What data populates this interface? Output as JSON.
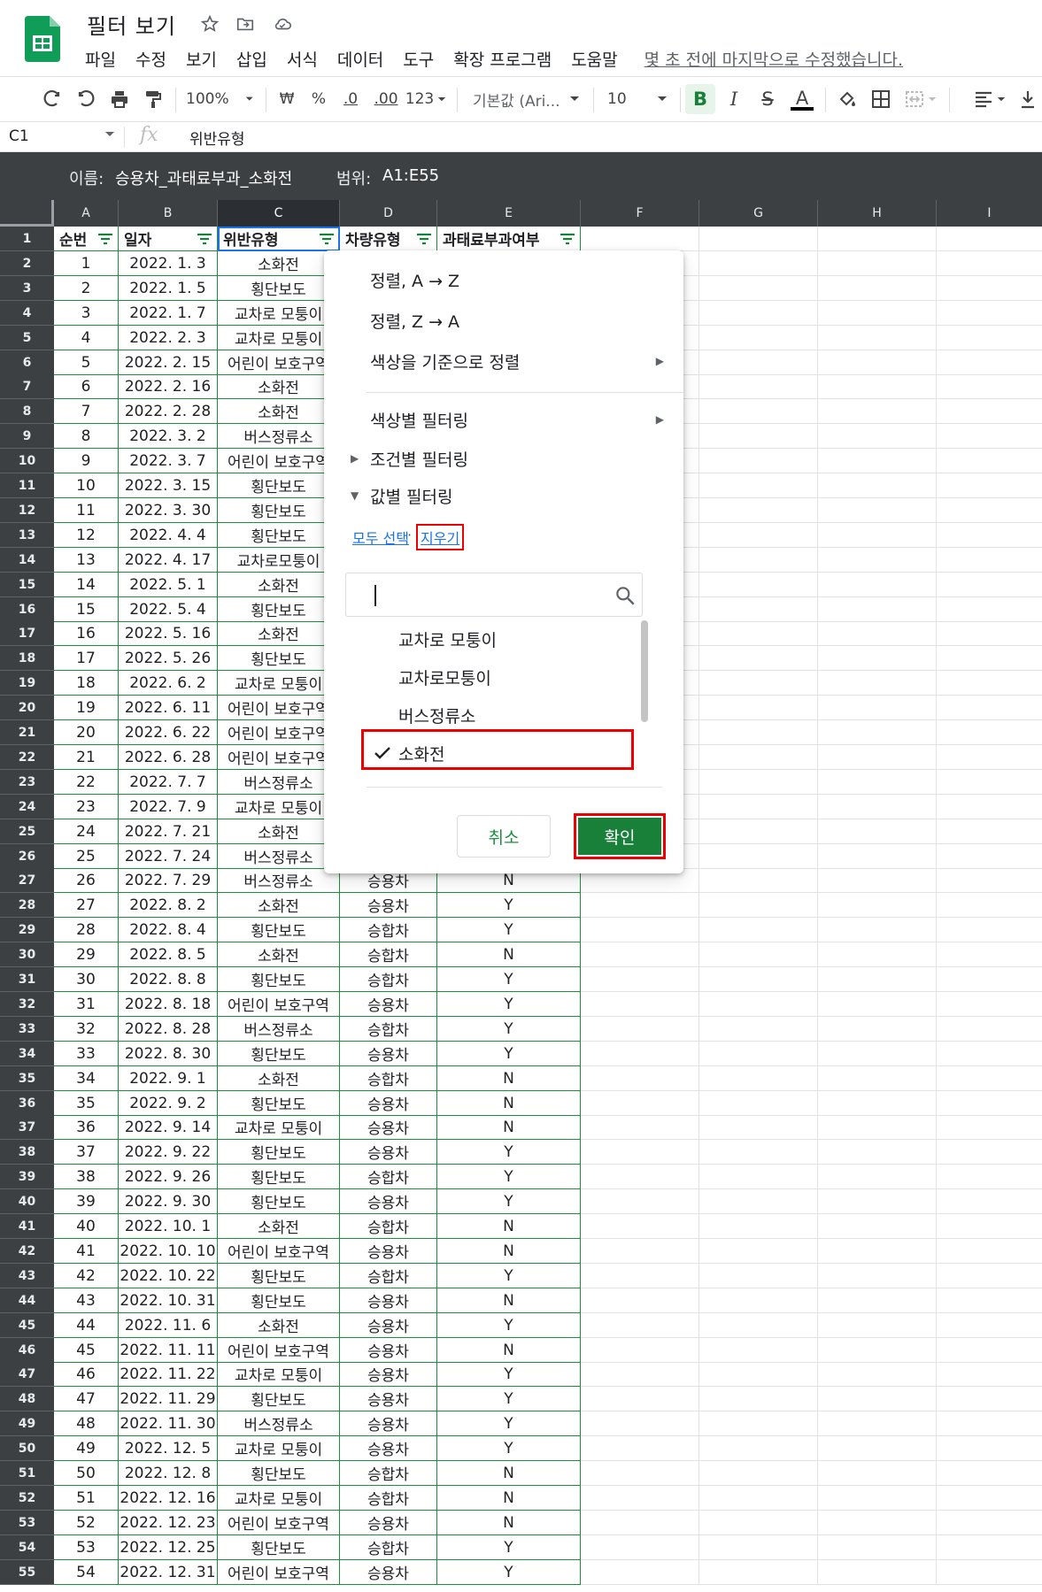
{
  "doc": {
    "title": "필터 보기",
    "last_edit": "몇 초 전에 마지막으로 수정했습니다."
  },
  "menu": [
    "파일",
    "수정",
    "보기",
    "삽입",
    "서식",
    "데이터",
    "도구",
    "확장 프로그램",
    "도움말"
  ],
  "toolbar": {
    "zoom": "100%",
    "currency": "₩",
    "percent": "%",
    "dec_decrease": ".0",
    "dec_increase": ".00",
    "number_format": "123",
    "font": "기본값 (Ari...",
    "font_size": "10",
    "bold": "B",
    "italic": "I",
    "strike": "S",
    "text_color": "A"
  },
  "formula_bar": {
    "cell": "C1",
    "fx": "fx",
    "value": "위반유형"
  },
  "filter_view": {
    "name_label": "이름:",
    "name": "승용차_과태료부과_소화전",
    "range_label": "범위:",
    "range": "A1:E55"
  },
  "columns": [
    "A",
    "B",
    "C",
    "D",
    "E",
    "F",
    "G",
    "H",
    "I"
  ],
  "headers": [
    "순번",
    "일자",
    "위반유형",
    "차량유형",
    "과태료부과여부"
  ],
  "rows": [
    [
      "1",
      "2022. 1. 3",
      "소화전",
      "",
      ""
    ],
    [
      "2",
      "2022. 1. 5",
      "횡단보도",
      "",
      ""
    ],
    [
      "3",
      "2022. 1. 7",
      "교차로 모퉁이",
      "",
      ""
    ],
    [
      "4",
      "2022. 2. 3",
      "교차로 모퉁이",
      "",
      ""
    ],
    [
      "5",
      "2022. 2. 15",
      "어린이 보호구역",
      "",
      ""
    ],
    [
      "6",
      "2022. 2. 16",
      "소화전",
      "",
      ""
    ],
    [
      "7",
      "2022. 2. 28",
      "소화전",
      "",
      ""
    ],
    [
      "8",
      "2022. 3. 2",
      "버스정류소",
      "",
      ""
    ],
    [
      "9",
      "2022. 3. 7",
      "어린이 보호구역",
      "",
      ""
    ],
    [
      "10",
      "2022. 3. 15",
      "횡단보도",
      "",
      ""
    ],
    [
      "11",
      "2022. 3. 30",
      "횡단보도",
      "",
      ""
    ],
    [
      "12",
      "2022. 4. 4",
      "횡단보도",
      "",
      ""
    ],
    [
      "13",
      "2022. 4. 17",
      "교차로모퉁이",
      "",
      ""
    ],
    [
      "14",
      "2022. 5. 1",
      "소화전",
      "",
      ""
    ],
    [
      "15",
      "2022. 5. 4",
      "횡단보도",
      "",
      ""
    ],
    [
      "16",
      "2022. 5. 16",
      "소화전",
      "",
      ""
    ],
    [
      "17",
      "2022. 5. 26",
      "횡단보도",
      "",
      ""
    ],
    [
      "18",
      "2022. 6. 2",
      "교차로 모퉁이",
      "",
      ""
    ],
    [
      "19",
      "2022. 6. 11",
      "어린이 보호구역",
      "",
      ""
    ],
    [
      "20",
      "2022. 6. 22",
      "어린이 보호구역",
      "",
      ""
    ],
    [
      "21",
      "2022. 6. 28",
      "어린이 보호구역",
      "",
      ""
    ],
    [
      "22",
      "2022. 7. 7",
      "버스정류소",
      "",
      ""
    ],
    [
      "23",
      "2022. 7. 9",
      "교차로 모퉁이",
      "",
      ""
    ],
    [
      "24",
      "2022. 7. 21",
      "소화전",
      "",
      ""
    ],
    [
      "25",
      "2022. 7. 24",
      "버스정류소",
      "",
      ""
    ],
    [
      "26",
      "2022. 7. 29",
      "버스정류소",
      "승용차",
      "N"
    ],
    [
      "27",
      "2022. 8. 2",
      "소화전",
      "승용차",
      "Y"
    ],
    [
      "28",
      "2022. 8. 4",
      "횡단보도",
      "승합차",
      "Y"
    ],
    [
      "29",
      "2022. 8. 5",
      "소화전",
      "승합차",
      "N"
    ],
    [
      "30",
      "2022. 8. 8",
      "횡단보도",
      "승합차",
      "Y"
    ],
    [
      "31",
      "2022. 8. 18",
      "어린이 보호구역",
      "승용차",
      "Y"
    ],
    [
      "32",
      "2022. 8. 28",
      "버스정류소",
      "승합차",
      "Y"
    ],
    [
      "33",
      "2022. 8. 30",
      "횡단보도",
      "승용차",
      "Y"
    ],
    [
      "34",
      "2022. 9. 1",
      "소화전",
      "승합차",
      "N"
    ],
    [
      "35",
      "2022. 9. 2",
      "횡단보도",
      "승용차",
      "N"
    ],
    [
      "36",
      "2022. 9. 14",
      "교차로 모퉁이",
      "승용차",
      "N"
    ],
    [
      "37",
      "2022. 9. 22",
      "횡단보도",
      "승용차",
      "Y"
    ],
    [
      "38",
      "2022. 9. 26",
      "횡단보도",
      "승합차",
      "Y"
    ],
    [
      "39",
      "2022. 9. 30",
      "횡단보도",
      "승용차",
      "Y"
    ],
    [
      "40",
      "2022. 10. 1",
      "소화전",
      "승합차",
      "N"
    ],
    [
      "41",
      "2022. 10. 10",
      "어린이 보호구역",
      "승용차",
      "N"
    ],
    [
      "42",
      "2022. 10. 22",
      "횡단보도",
      "승합차",
      "Y"
    ],
    [
      "43",
      "2022. 10. 31",
      "횡단보도",
      "승용차",
      "N"
    ],
    [
      "44",
      "2022. 11. 6",
      "소화전",
      "승용차",
      "Y"
    ],
    [
      "45",
      "2022. 11. 11",
      "어린이 보호구역",
      "승용차",
      "N"
    ],
    [
      "46",
      "2022. 11. 22",
      "교차로 모퉁이",
      "승용차",
      "Y"
    ],
    [
      "47",
      "2022. 11. 29",
      "횡단보도",
      "승용차",
      "Y"
    ],
    [
      "48",
      "2022. 11. 30",
      "버스정류소",
      "승용차",
      "Y"
    ],
    [
      "49",
      "2022. 12. 5",
      "교차로 모퉁이",
      "승용차",
      "Y"
    ],
    [
      "50",
      "2022. 12. 8",
      "횡단보도",
      "승합차",
      "N"
    ],
    [
      "51",
      "2022. 12. 16",
      "교차로 모퉁이",
      "승합차",
      "N"
    ],
    [
      "52",
      "2022. 12. 23",
      "어린이 보호구역",
      "승용차",
      "N"
    ],
    [
      "53",
      "2022. 12. 25",
      "횡단보도",
      "승합차",
      "Y"
    ],
    [
      "54",
      "2022. 12. 31",
      "어린이 보호구역",
      "승용차",
      "Y"
    ]
  ],
  "filter_menu": {
    "sort_az": "정렬, A → Z",
    "sort_za": "정렬, Z → A",
    "sort_color": "색상을 기준으로 정렬",
    "filter_color": "색상별 필터링",
    "filter_condition": "조건별 필터링",
    "filter_values": "값별 필터링",
    "select_all": "모두 선택",
    "separator": "·",
    "clear": "지우기",
    "values": [
      {
        "label": "교차로 모퉁이",
        "checked": false
      },
      {
        "label": "교차로모퉁이",
        "checked": false
      },
      {
        "label": "버스정류소",
        "checked": false
      },
      {
        "label": "소화전",
        "checked": true
      }
    ],
    "cancel": "취소",
    "ok": "확인"
  },
  "colors": {
    "accent_green": "#188038",
    "highlight_red": "#e00000",
    "link_blue": "#1a73e8",
    "filter_bar": "#3c4043"
  }
}
